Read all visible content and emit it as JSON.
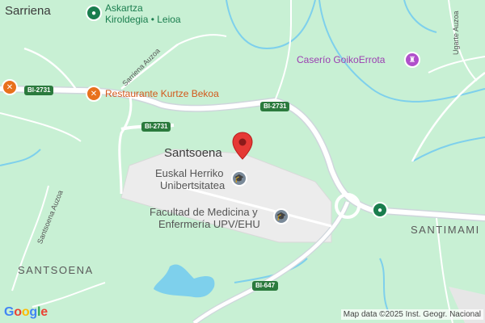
{
  "labels": {
    "sarriena": "Sarriena",
    "santsoena_town": "Santsoena",
    "santsoena_area": "SANTSOENA",
    "santimami": "SANTIMAMI",
    "askartza_line1": "Askartza",
    "askartza_line2": "Kiroldegia • Leioa",
    "restaurante": "Restaurante Kurtze Bekoa",
    "caserio": "Caserío GoikoErrota",
    "ehu_line1": "Euskal Herriko",
    "ehu_line2": "Unibertsitatea",
    "medicina_line1": "Facultad de Medicina y",
    "medicina_line2": "Enfermería UPV/EHU",
    "sarriena_auzoa": "Sarriena Auzoa",
    "santsoena_auzoa": "Santsoena Auzoa",
    "ugarte_auzoa": "Ugarte Auzoa"
  },
  "roads": {
    "bi2731_a": "BI-2731",
    "bi2731_b": "BI-2731",
    "bi2731_c": "BI-2731",
    "bi647": "BI-647"
  },
  "attribution": "Map data ©2025 Inst. Geogr. Nacional",
  "logo": {
    "letters": [
      "G",
      "o",
      "o",
      "g",
      "l",
      "e"
    ],
    "colors": [
      "#4285F4",
      "#EA4335",
      "#FBBC05",
      "#4285F4",
      "#34A853",
      "#EA4335"
    ]
  },
  "colors": {
    "land": "#c8f0d4",
    "campus": "#ececec",
    "water": "#7ed0ec",
    "road": "#ffffff",
    "pin": "#e53935",
    "poi_green": "#1a7d4e",
    "poi_orange": "#e8711c",
    "poi_purple": "#b04fcb"
  },
  "icons": {
    "marker": "map-pin-icon",
    "askartza": "sports-poi-icon",
    "restaurant": "restaurant-icon",
    "caserio": "castle-icon",
    "university": "graduation-cap-icon",
    "santimami": "green-place-icon"
  }
}
